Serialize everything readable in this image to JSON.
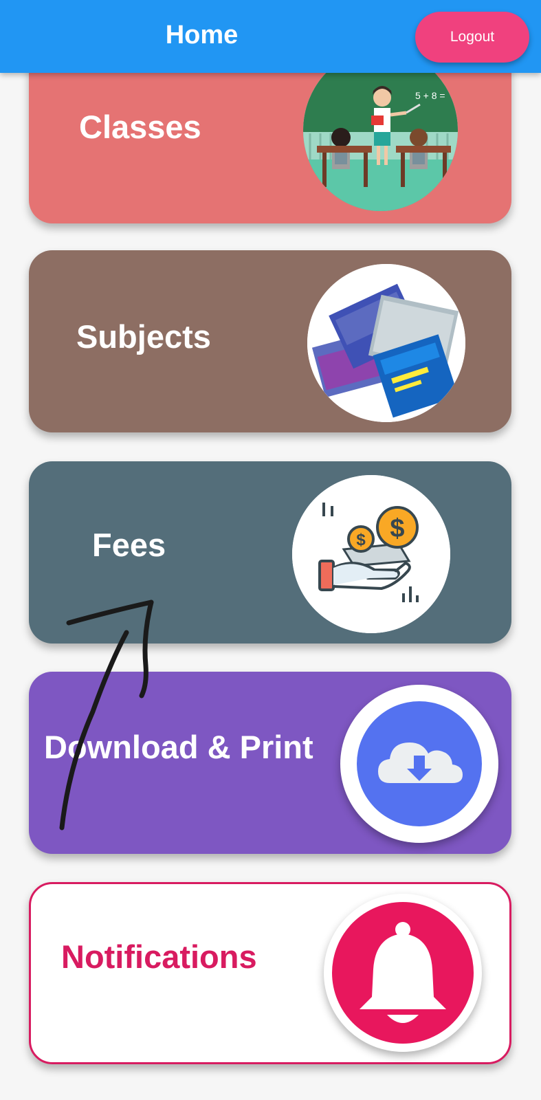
{
  "appbar": {
    "title": "Home",
    "logout_label": "Logout",
    "color": "#2196f3",
    "logout_color": "#f0417e"
  },
  "menu": {
    "cards": [
      {
        "label": "Classes",
        "color": "#e57373",
        "icon": "classroom-teacher-image"
      },
      {
        "label": "Subjects",
        "color": "#8d6e63",
        "icon": "textbooks-image"
      },
      {
        "label": "Fees",
        "color": "#546e7a",
        "icon": "coins-hand-icon"
      },
      {
        "label": "Download & Print",
        "color": "#7e57c2",
        "icon": "cloud-download-icon"
      },
      {
        "label": "Notifications",
        "color": "#d81b60",
        "icon": "bell-icon"
      }
    ]
  },
  "classroom_board_text": "5 + 8 ="
}
